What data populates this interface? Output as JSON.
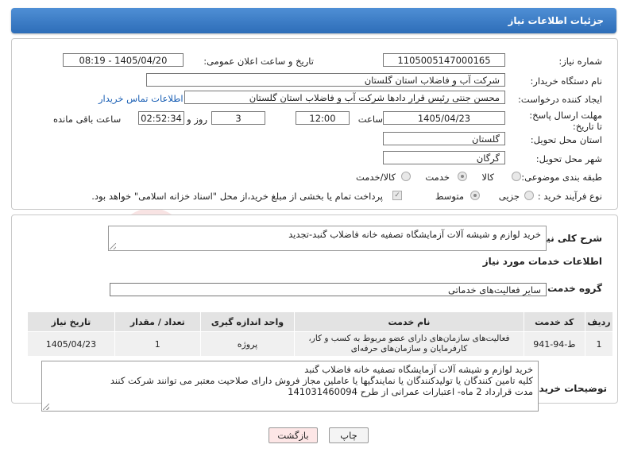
{
  "header": {
    "title": "جزئیات اطلاعات نیاز"
  },
  "form": {
    "need_number_label": "شماره نیاز:",
    "need_number": "1105005147000165",
    "announce_label": "تاریخ و ساعت اعلان عمومی:",
    "announce_value": "1405/04/20 - 08:19",
    "buyer_label": "نام دستگاه خریدار:",
    "buyer_value": "شرکت آب و فاضلاب استان گلستان",
    "creator_label": "ایجاد کننده درخواست:",
    "creator_value": "محسن جنتی رئیس قرار دادها شرکت آب و فاضلاب استان گلستان",
    "contact_link": "اطلاعات تماس خریدار",
    "deadline_label": "مهلت ارسال پاسخ: تا تاریخ:",
    "deadline_date": "1405/04/23",
    "time_label": "ساعت",
    "deadline_time": "12:00",
    "days_value": "3",
    "days_label": "روز و",
    "remaining_value": "02:52:34",
    "remaining_label": "ساعت باقی مانده",
    "province_label": "استان محل تحویل:",
    "province_value": "گلستان",
    "city_label": "شهر محل تحویل:",
    "city_value": "گرگان",
    "category_label": "طبقه بندی موضوعی:",
    "category_options": [
      "کالا",
      "خدمت",
      "کالا/خدمت"
    ],
    "category_selected": "خدمت",
    "process_label": "نوع فرآیند خرید :",
    "process_options": [
      "جزیی",
      "متوسط"
    ],
    "process_selected": "متوسط",
    "payment_note": "پرداخت تمام یا بخشی از مبلغ خرید،از محل \"اسناد خزانه اسلامی\" خواهد بود."
  },
  "description": {
    "label": "شرح کلی نیاز:",
    "value": "خرید لوازم و شیشه آلات آزمایشگاه تصفیه خانه فاضلاب گنبد-تجدید"
  },
  "services": {
    "title": "اطلاعات خدمات مورد نیاز",
    "group_label": "گروه خدمت:",
    "group_value": "سایر فعالیت‌های خدماتی",
    "columns": [
      "ردیف",
      "کد خدمت",
      "نام خدمت",
      "واحد اندازه گیری",
      "تعداد / مقدار",
      "تاریخ نیاز"
    ],
    "rows": [
      {
        "index": "1",
        "code": "ط-94-941",
        "name": "فعالیت‌های سازمان‌های دارای عضو مربوط به کسب و کار، کارفرمایان و سازمان‌های حرفه‌ای",
        "unit": "پروژه",
        "qty": "1",
        "date": "1405/04/23"
      }
    ]
  },
  "buyer_notes": {
    "label": "توضیحات خریدار:",
    "line1": "خرید لوازم  و شیشه آلات آزمایشگاه تصفیه خانه فاضلاب گنبد",
    "line2": "کلیه تامین کنندگان یا تولیدکنندگان یا نمایندگیها یا عاملین مجاز فروش دارای صلاحیت معتبر می توانند شرکت کنند",
    "line3": "مدت قرارداد 2 ماه- اعتبارات عمرانی از طرح 141031460094"
  },
  "buttons": {
    "print": "چاپ",
    "back": "بازگشت"
  },
  "colors": {
    "header": "#3a7cc8",
    "link": "#1a5fb4",
    "back_button": "#fde6e6"
  }
}
